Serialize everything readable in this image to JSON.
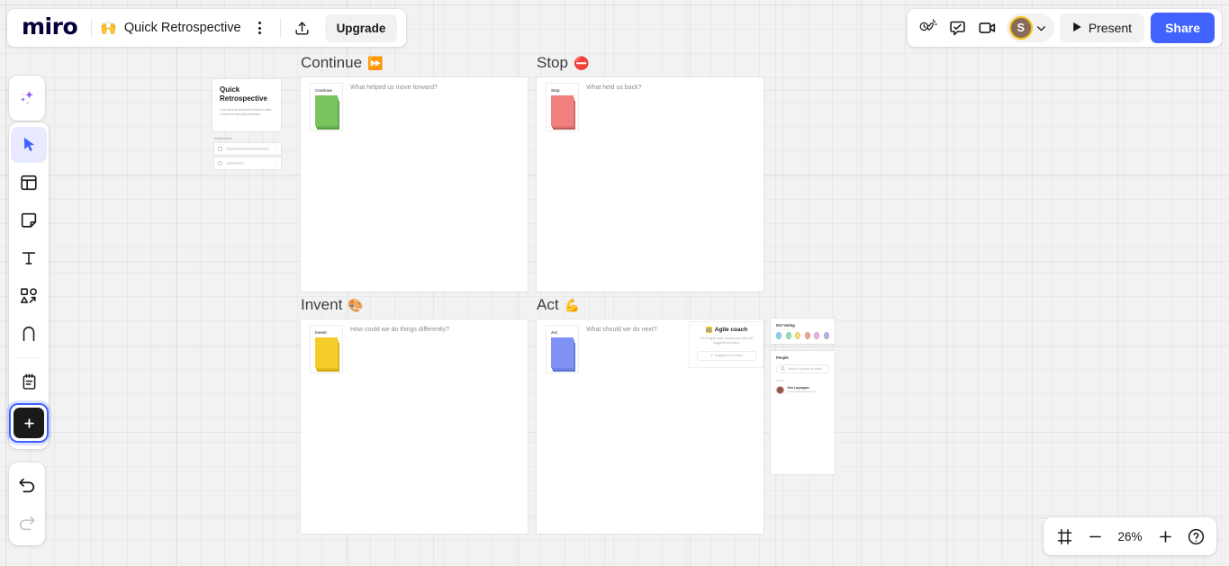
{
  "header": {
    "logo": "miro",
    "board_emoji": "🙌",
    "board_title": "Quick Retrospective",
    "kebab_name": "board-menu",
    "upgrade_label": "Upgrade",
    "present_label": "Present",
    "share_label": "Share",
    "avatar_initial": "S",
    "icons": {
      "share_export": "upload-icon",
      "reactions": "reactions-icon",
      "comment": "comment-icon",
      "video": "video-camera-icon",
      "chevron": "chevron-down-icon",
      "play": "play-icon"
    }
  },
  "toolbar": {
    "items": [
      {
        "name": "ai-tool",
        "icon": "sparkles-icon",
        "label": "AI"
      },
      {
        "name": "select-tool",
        "icon": "cursor-icon",
        "label": "Select"
      },
      {
        "name": "templates-tool",
        "icon": "templates-icon",
        "label": "Templates"
      },
      {
        "name": "sticky-note-tool",
        "icon": "sticky-note-icon",
        "label": "Sticky note"
      },
      {
        "name": "text-tool",
        "icon": "text-icon",
        "label": "Text"
      },
      {
        "name": "shapes-tool",
        "icon": "shapes-icon",
        "label": "Shapes and connectors"
      },
      {
        "name": "pen-tool",
        "icon": "pen-icon",
        "label": "Pen"
      },
      {
        "name": "notes-tool",
        "icon": "notepad-icon",
        "label": "Notes"
      },
      {
        "name": "more-apps-tool",
        "icon": "plus-square-icon",
        "label": "More apps"
      },
      {
        "name": "undo-tool",
        "icon": "undo-arrow-icon",
        "label": "Undo"
      },
      {
        "name": "redo-tool",
        "icon": "redo-arrow-icon",
        "label": "Redo"
      }
    ]
  },
  "board": {
    "preview_card": {
      "title": "Quick Retrospective",
      "description": "Look back at sprint and reflect in order to improve everyday practices.",
      "sub_heading": "Activity steps",
      "rows": [
        {
          "icon": "note-icon"
        },
        {
          "icon": "clock-icon"
        }
      ]
    },
    "frames": [
      {
        "name": "frame-continue",
        "title": "Continue",
        "emoji": "⏩",
        "sticky_label": "Continue",
        "prompt": "What helped us move forward?",
        "color": "#7ac45e",
        "shade": "#5f9e49"
      },
      {
        "name": "frame-stop",
        "title": "Stop",
        "emoji": "⛔",
        "sticky_label": "Stop",
        "prompt": "What held us back?",
        "color": "#f08080",
        "shade": "#c25c5c"
      },
      {
        "name": "frame-invent",
        "title": "Invent",
        "emoji": "🎨",
        "sticky_label": "Invent",
        "prompt": "How could we do things differently?",
        "color": "#f5cc2a",
        "shade": "#cfa814"
      },
      {
        "name": "frame-act",
        "title": "Act",
        "emoji": "💪",
        "sticky_label": "Act",
        "prompt": "What should we do next?",
        "color": "#8093f5",
        "shade": "#5f72d4"
      }
    ],
    "agile_coach": {
      "title": "Agile coach",
      "badge_emoji": "🤖",
      "description": "The AI agile coach reviews your retro and suggests next steps.",
      "button_label": "Suggest next steps",
      "button_icon": "sparkles-icon"
    },
    "dot_voting": {
      "title": "Dot Voting",
      "dots": [
        "#8fd0f0",
        "#96dfb0",
        "#f5e07a",
        "#f5a0a0",
        "#f0b0d8",
        "#c0b0ef"
      ]
    },
    "people": {
      "title": "People",
      "search_placeholder": "Search by name or email",
      "search_icon": "search-icon",
      "section_label": "Online",
      "members": [
        {
          "name": "Sen Laysagan",
          "email": "senlaysagan@gmail.com"
        }
      ]
    }
  },
  "zoombar": {
    "fit_icon": "frames-icon",
    "zoom_out_icon": "minus-icon",
    "zoom_level": "26%",
    "zoom_in_icon": "plus-icon",
    "help_icon": "help-circle-icon"
  }
}
